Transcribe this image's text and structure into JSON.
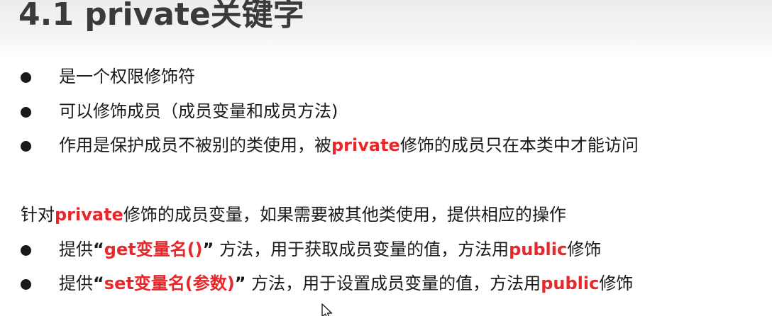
{
  "title": "4.1 private关键字",
  "bullets_top": [
    {
      "parts": [
        {
          "t": "是一个权限修饰符",
          "hl": false
        }
      ]
    },
    {
      "parts": [
        {
          "t": "可以修饰成员（成员变量和成员方法)",
          "hl": false
        }
      ]
    },
    {
      "parts": [
        {
          "t": "作用是保护成员不被别的类使用，被",
          "hl": false
        },
        {
          "t": "private",
          "hl": true
        },
        {
          "t": "修饰的成员只在本类中才能访问",
          "hl": false
        }
      ]
    }
  ],
  "section_line": {
    "parts": [
      {
        "t": "针对",
        "hl": false
      },
      {
        "t": "private",
        "hl": true
      },
      {
        "t": "修饰的成员变量，如果需要被其他类使用，提供相应的操作",
        "hl": false
      }
    ]
  },
  "bullets_bottom": [
    {
      "parts": [
        {
          "t": "提供",
          "hl": false
        },
        {
          "t": "“",
          "hl": false,
          "bold": true
        },
        {
          "t": "get变量名()",
          "hl": true
        },
        {
          "t": "”",
          "hl": false,
          "bold": true
        },
        {
          "t": " 方法，用于获取成员变量的值，方法用",
          "hl": false
        },
        {
          "t": "public",
          "hl": true
        },
        {
          "t": "修饰",
          "hl": false
        }
      ]
    },
    {
      "parts": [
        {
          "t": "提供",
          "hl": false
        },
        {
          "t": "“",
          "hl": false,
          "bold": true
        },
        {
          "t": "set变量名(参数)",
          "hl": true
        },
        {
          "t": "”",
          "hl": false,
          "bold": true
        },
        {
          "t": " 方法，用于设置成员变量的值，方法用",
          "hl": false
        },
        {
          "t": "public",
          "hl": true
        },
        {
          "t": "修饰",
          "hl": false
        }
      ]
    }
  ],
  "colors": {
    "highlight": "#e8272b",
    "text": "#1a1a1a",
    "title": "#3a3a3a"
  },
  "cursor_icon": "mouse-pointer-icon"
}
